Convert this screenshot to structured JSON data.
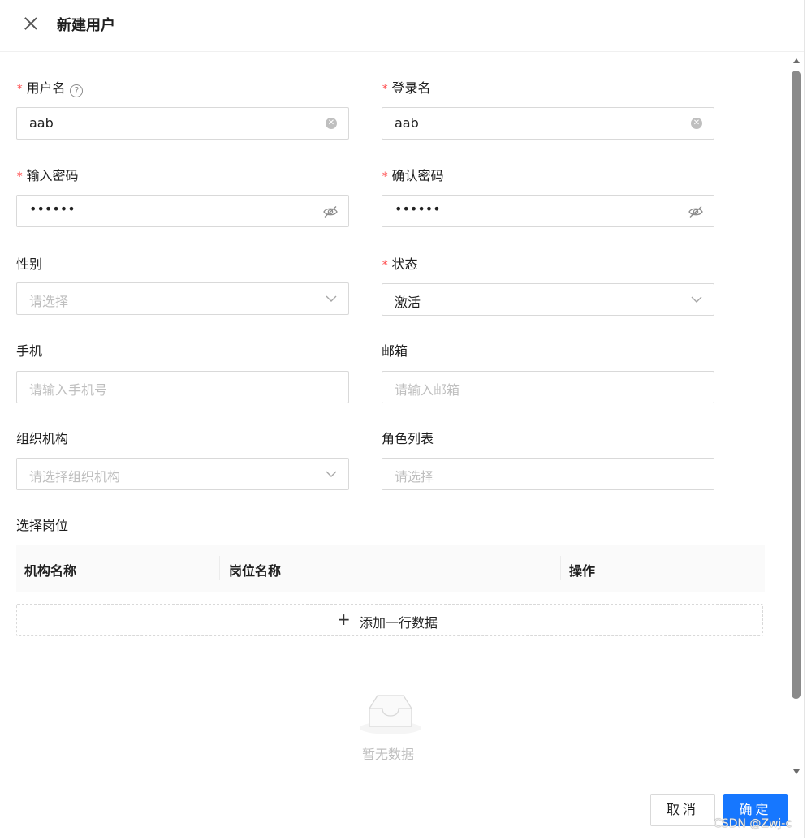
{
  "header": {
    "title": "新建用户"
  },
  "form": {
    "username": {
      "label": "用户名",
      "value": "aab"
    },
    "login_name": {
      "label": "登录名",
      "value": "aab"
    },
    "password": {
      "label": "输入密码",
      "value": "••••••"
    },
    "confirm_password": {
      "label": "确认密码",
      "value": "••••••"
    },
    "gender": {
      "label": "性别",
      "placeholder": "请选择"
    },
    "status": {
      "label": "状态",
      "value": "激活"
    },
    "phone": {
      "label": "手机",
      "placeholder": "请输入手机号"
    },
    "email": {
      "label": "邮箱",
      "placeholder": "请输入邮箱"
    },
    "org": {
      "label": "组织机构",
      "placeholder": "请选择组织机构"
    },
    "roles": {
      "label": "角色列表",
      "placeholder": "请选择"
    }
  },
  "positions": {
    "label": "选择岗位",
    "columns": [
      "机构名称",
      "岗位名称",
      "操作"
    ],
    "add_row_label": "添加一行数据",
    "empty_text": "暂无数据"
  },
  "footer": {
    "cancel_label": "取消",
    "ok_label": "确定"
  },
  "watermark": "CSDN @Zwj-c",
  "colors": {
    "primary": "#1677ff",
    "required": "#ff4d4f"
  }
}
